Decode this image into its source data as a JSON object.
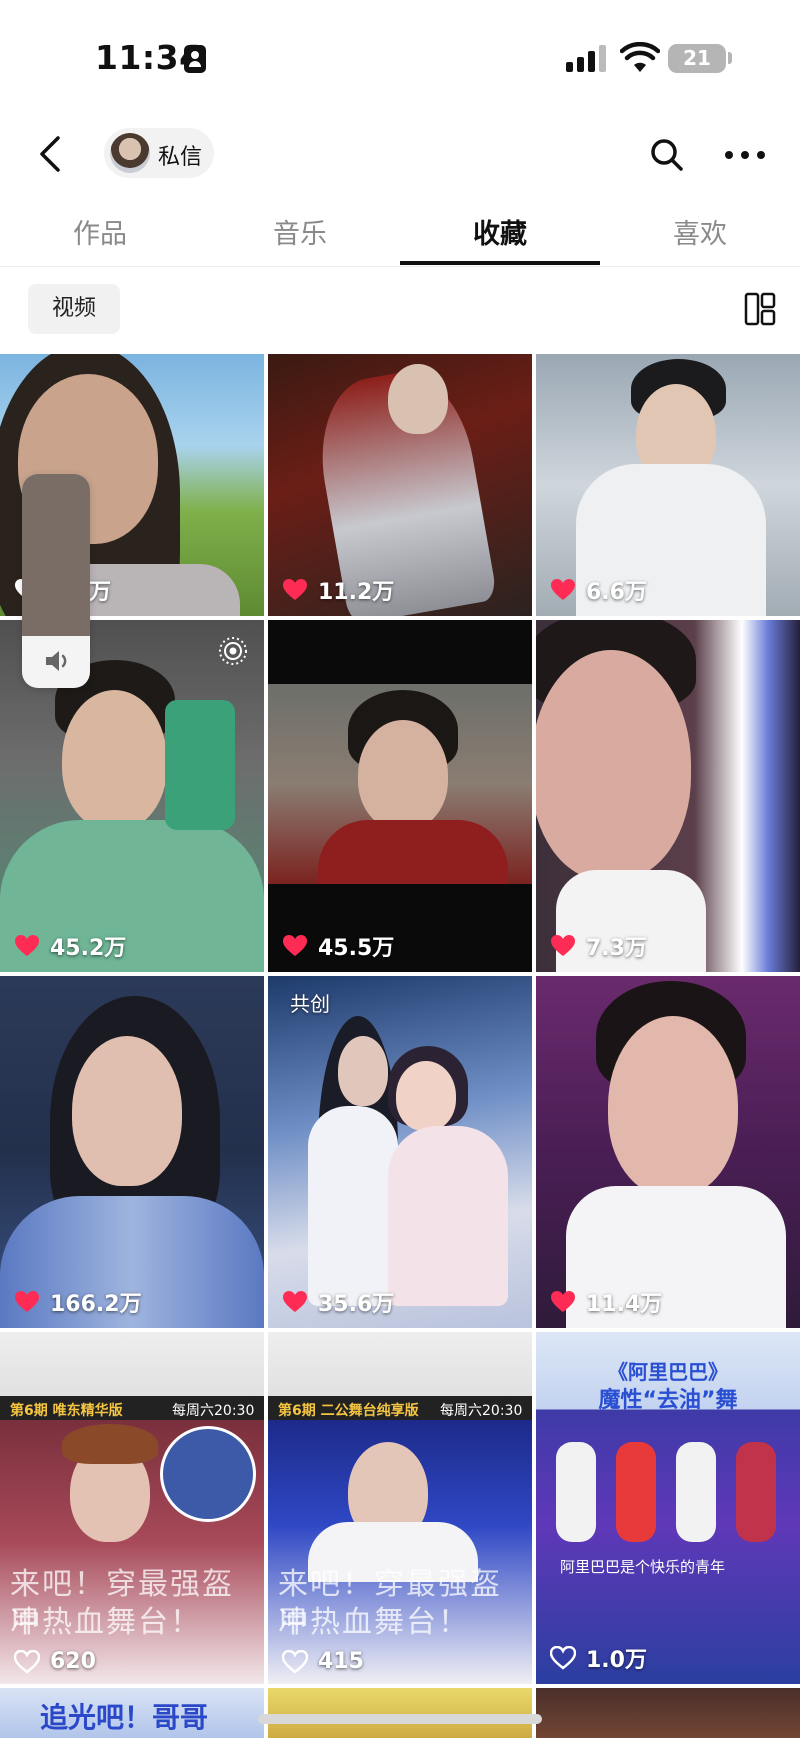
{
  "status_bar": {
    "time": "11:34",
    "battery": "21"
  },
  "header": {
    "dm_label": "私信"
  },
  "tabs": [
    {
      "label": "作品",
      "active": false
    },
    {
      "label": "音乐",
      "active": false
    },
    {
      "label": "收藏",
      "active": true
    },
    {
      "label": "喜欢",
      "active": false
    }
  ],
  "filter": {
    "selected": "视频"
  },
  "videos": [
    {
      "likes": "9.0万"
    },
    {
      "likes": "11.2万"
    },
    {
      "likes": "6.6万"
    },
    {
      "likes": "45.2万"
    },
    {
      "likes": "45.5万"
    },
    {
      "likes": "7.3万"
    },
    {
      "likes": "166.2万"
    },
    {
      "likes": "35.6万",
      "tag": "共创"
    },
    {
      "likes": "11.4万"
    },
    {
      "likes": "620",
      "banner": "第6期 唯东精华版",
      "banner_right": "每周六20:30",
      "overlay": [
        "来吧！穿最强盔甲",
        "冲热血舞台！"
      ]
    },
    {
      "likes": "415",
      "banner": "第6期 二公舞台纯享版",
      "banner_right": "每周六20:30",
      "overlay": [
        "来吧！穿最强盔甲",
        "冲热血舞台！"
      ]
    },
    {
      "likes": "1.0万",
      "title_lines": [
        "《阿里巴巴》",
        "魔性“去油”舞"
      ],
      "caption": "阿里巴巴是个快乐的青年"
    }
  ],
  "partial_row": {
    "text": "追光吧！哥哥"
  },
  "colors": {
    "like_red": "#fe2c55",
    "tab_underline": "#111111"
  }
}
